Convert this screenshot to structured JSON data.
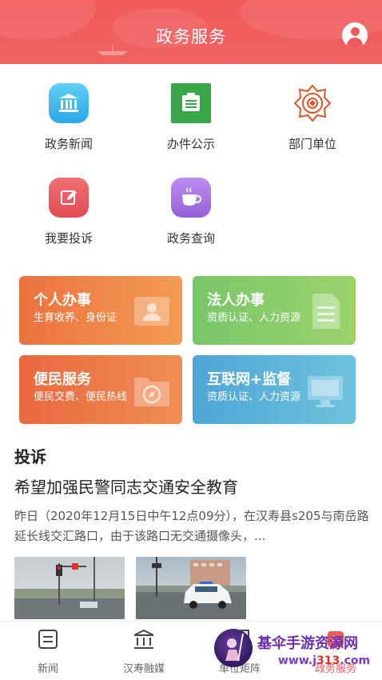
{
  "header": {
    "title": "政务服务"
  },
  "grid": [
    {
      "label": "政务新闻",
      "icon": "bank-icon",
      "color": "#3fb6ea"
    },
    {
      "label": "办件公示",
      "icon": "document-board-icon",
      "color": "#37a74a"
    },
    {
      "label": "部门单位",
      "icon": "police-emblem-icon",
      "color": "#d9562b"
    },
    {
      "label": "我要投诉",
      "icon": "edit-icon",
      "color": "#e8565a"
    },
    {
      "label": "政务查询",
      "icon": "coffee-cup-icon",
      "color": "#a772e0"
    }
  ],
  "cards": [
    {
      "title": "个人办事",
      "subtitle": "生育收养、身份证",
      "icon": "id-card-icon"
    },
    {
      "title": "法人办事",
      "subtitle": "资质认证、人力资源",
      "icon": "document-icon"
    },
    {
      "title": "便民服务",
      "subtitle": "便民交费、便民热线",
      "icon": "folder-compass-icon"
    },
    {
      "title": "互联网+监督",
      "subtitle": "资质认证、人力资源",
      "icon": "monitor-icon"
    }
  ],
  "section": {
    "title": "投诉",
    "news_title": "希望加强民警同志交通安全教育",
    "news_body": "昨日（2020年12月15日中午12点09分），在汉寿县s205与南岳路延长线交汇路口，由于该路口无交通摄像头，..."
  },
  "tabs": [
    {
      "label": "新闻",
      "icon": "news-icon"
    },
    {
      "label": "汉寿融媒",
      "icon": "bank-icon"
    },
    {
      "label": "单位矩阵",
      "icon": "matrix-icon"
    },
    {
      "label": "政务服务",
      "icon": "service-icon"
    }
  ],
  "watermark": {
    "name": "基伞手游资源网",
    "url_prefix": "www.j",
    "url_highlight": "313",
    "url_suffix": ".com"
  }
}
